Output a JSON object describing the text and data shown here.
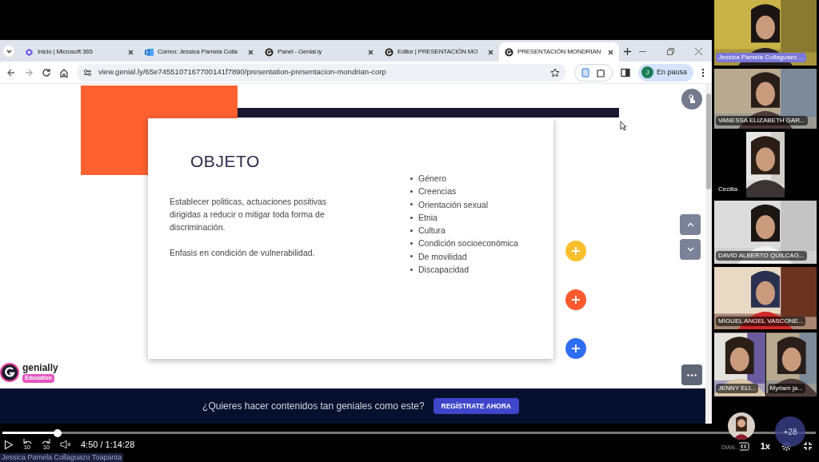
{
  "browser": {
    "tabs": [
      {
        "kind": "microsoft",
        "label": "Inicio | Microsoft 365",
        "selected": false
      },
      {
        "kind": "outlook",
        "label": "Correo: Jessica Pamela Colla",
        "selected": false
      },
      {
        "kind": "genially",
        "label": "Panel - Genial.ly",
        "selected": false
      },
      {
        "kind": "genially",
        "label": "Editor | PRESENTACIÓN MO",
        "selected": false
      },
      {
        "kind": "genially",
        "label": "PRESENTACIÓN MONDRIAN",
        "selected": true
      }
    ],
    "url": "view.genial.ly/65e7455107167700141f7890/presentation-presentacion-mondrian-corp",
    "profile": {
      "initial": "J",
      "label": "En pausa"
    }
  },
  "slide": {
    "title": "OBJETO",
    "paragraphs": [
      "Establecer politicas, actuaciones positivas dirigidas a reducir o mitigar toda forma de discriminación.",
      "Enfasis en condición de vulnerabilidad."
    ],
    "bullets": [
      "Género",
      "Creencias",
      "Orientación sexual",
      "Etnia",
      "Cultura",
      "Condición socioeconómica",
      "De movilidad",
      "Discapacidad"
    ],
    "hotspots": [
      {
        "color": "#fbbf2d"
      },
      {
        "color": "#fb5a2f"
      },
      {
        "color": "#2f6df5"
      }
    ]
  },
  "brand": {
    "name": "genially",
    "badge": "Education"
  },
  "banner": {
    "text": "¿Quieres hacer contenidos tan geniales como este?",
    "button": "REGÍSTRATE AHORA"
  },
  "participants": [
    {
      "tiles": [
        {
          "name": "Jessica Pamela Collaguazo ...",
          "highlighted": true
        }
      ]
    },
    {
      "tiles": [
        {
          "name": "VANESSA ELIZABETH GAR...",
          "highlighted": false
        }
      ]
    },
    {
      "tiles": [
        {
          "name": "Cecilia",
          "highlighted": false
        }
      ]
    },
    {
      "tiles": [
        {
          "name": "DAVID ALBERTO QUILCAG...",
          "highlighted": false
        }
      ]
    },
    {
      "tiles": [
        {
          "name": "MIGUEL ANGEL VASCONE...",
          "highlighted": false
        }
      ]
    },
    {
      "tiles": [
        {
          "name": "JENNY ELI...",
          "highlighted": false
        },
        {
          "name": "Myriam ja...",
          "highlighted": false
        }
      ]
    }
  ],
  "player": {
    "level": 0.068,
    "time": "4:50 / 1:14:28",
    "caption": "Jessica Pamela Collaguazo Toapanta",
    "avatar_name": "DIAN...",
    "more": "+28",
    "speed": "1x",
    "skip_back": "10",
    "skip_forward": "10"
  }
}
